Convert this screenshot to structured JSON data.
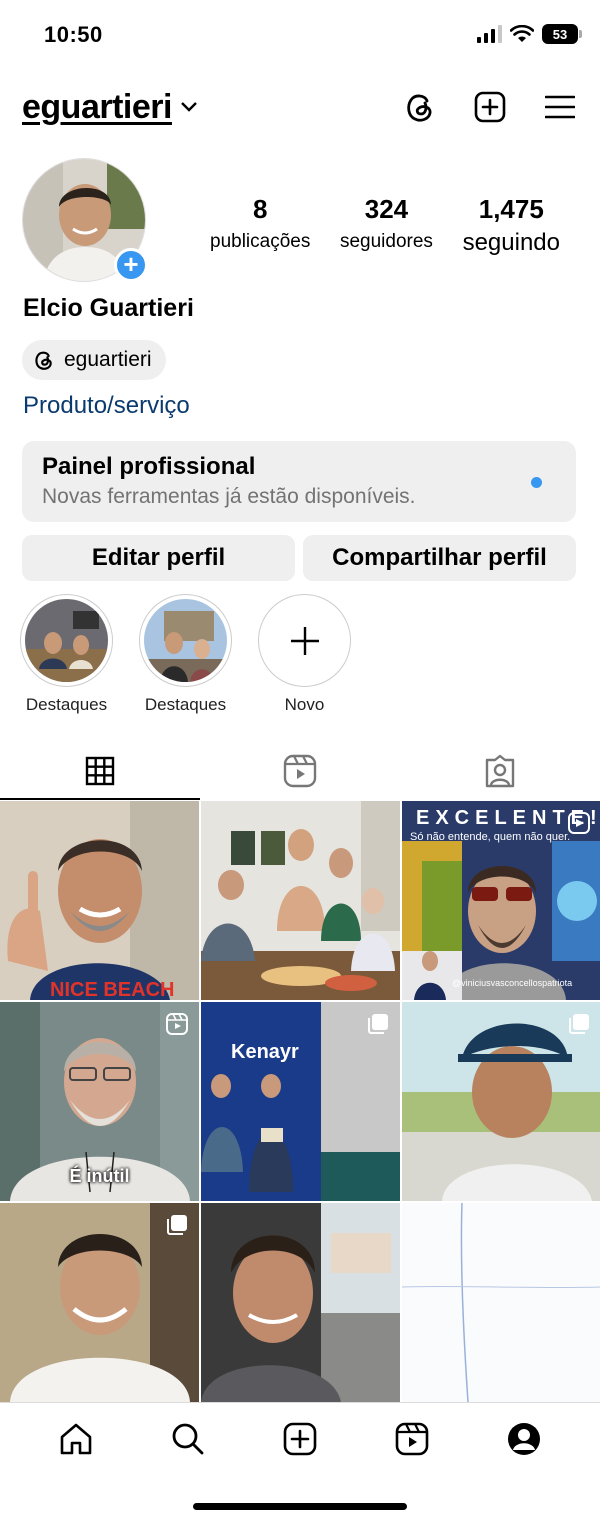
{
  "status_bar": {
    "time": "10:50",
    "battery": "53"
  },
  "header": {
    "username": "eguartieri"
  },
  "profile": {
    "stats": [
      {
        "value": "8",
        "label": "publicações"
      },
      {
        "value": "324",
        "label": "seguidores"
      },
      {
        "value": "1,475",
        "label": "seguindo"
      }
    ],
    "full_name": "Elcio Guartieri",
    "threads_handle": "eguartieri",
    "category": "Produto/serviço"
  },
  "pro_panel": {
    "title": "Painel profissional",
    "subtitle": "Novas ferramentas já estão disponíveis."
  },
  "buttons": {
    "edit": "Editar perfil",
    "share": "Compartilhar perfil"
  },
  "highlights": [
    {
      "label": "Destaques"
    },
    {
      "label": "Destaques"
    },
    {
      "label": "Novo"
    }
  ],
  "posts": [
    {
      "type": "photo"
    },
    {
      "type": "photo"
    },
    {
      "type": "reel",
      "title": "EXCELENTE!",
      "subtitle": "Só não entende, quem não quer.",
      "handle": "@viniciusvasconcellospatriota"
    },
    {
      "type": "reel",
      "caption": "É inútil"
    },
    {
      "type": "carousel",
      "brand": "Kenayr"
    },
    {
      "type": "carousel"
    },
    {
      "type": "carousel"
    },
    {
      "type": "photo"
    },
    {
      "type": "empty"
    }
  ],
  "colors": {
    "accent_blue": "#3897f0",
    "link_blue": "#0b3a6e",
    "panel_gray": "#efefef"
  }
}
